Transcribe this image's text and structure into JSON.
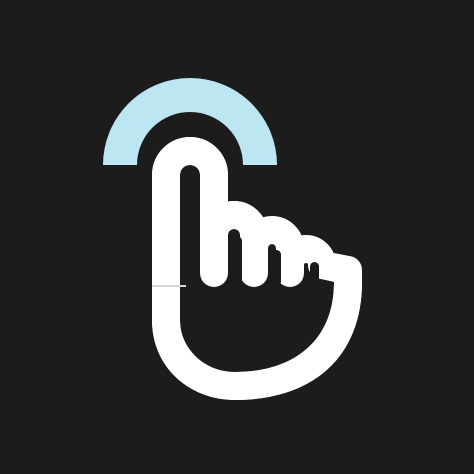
{
  "app_icon": {
    "icon": "tap-gesture-icon",
    "colors": {
      "background": "#1c1c1c",
      "hand": "#ffffff",
      "tap_wave": "#bde6f3",
      "hand_line": "#d8d8d8"
    }
  }
}
